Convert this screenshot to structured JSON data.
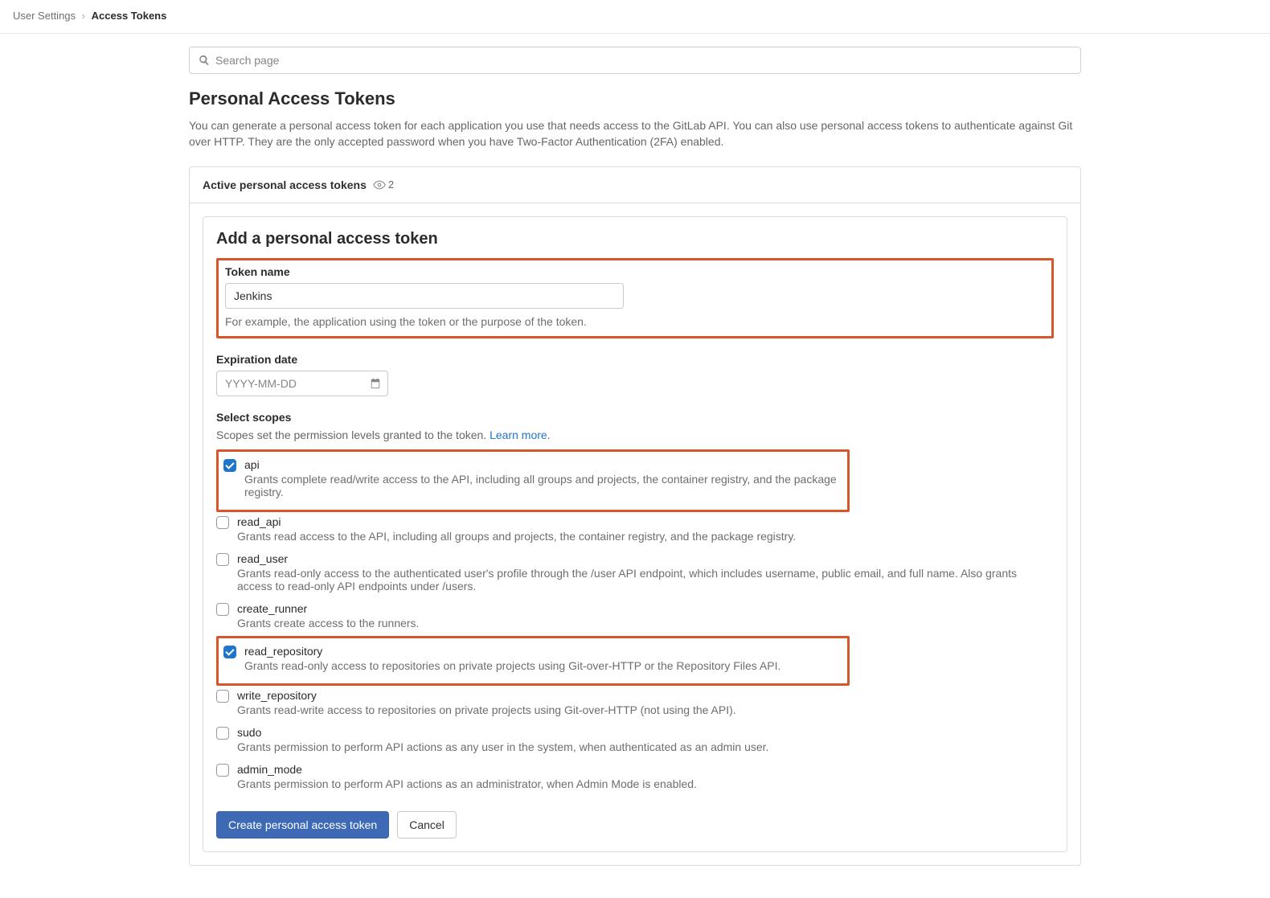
{
  "breadcrumbs": {
    "parent": "User Settings",
    "current": "Access Tokens"
  },
  "search": {
    "placeholder": "Search page"
  },
  "page": {
    "title": "Personal Access Tokens",
    "description": "You can generate a personal access token for each application you use that needs access to the GitLab API. You can also use personal access tokens to authenticate against Git over HTTP. They are the only accepted password when you have Two-Factor Authentication (2FA) enabled."
  },
  "panel": {
    "header": "Active personal access tokens",
    "count": "2"
  },
  "form": {
    "title": "Add a personal access token",
    "token_name_label": "Token name",
    "token_name_value": "Jenkins",
    "token_name_hint": "For example, the application using the token or the purpose of the token.",
    "expiration_label": "Expiration date",
    "expiration_placeholder": "YYYY-MM-DD",
    "scopes_label": "Select scopes",
    "scopes_desc_prefix": "Scopes set the permission levels granted to the token. ",
    "scopes_learn_more": "Learn more",
    "scopes_desc_suffix": ".",
    "create_label": "Create personal access token",
    "cancel_label": "Cancel"
  },
  "scopes": [
    {
      "key": "api",
      "name": "api",
      "desc": "Grants complete read/write access to the API, including all groups and projects, the container registry, and the package registry.",
      "checked": true,
      "highlight": true
    },
    {
      "key": "read_api",
      "name": "read_api",
      "desc": "Grants read access to the API, including all groups and projects, the container registry, and the package registry.",
      "checked": false,
      "highlight": false
    },
    {
      "key": "read_user",
      "name": "read_user",
      "desc": "Grants read-only access to the authenticated user's profile through the /user API endpoint, which includes username, public email, and full name. Also grants access to read-only API endpoints under /users.",
      "checked": false,
      "highlight": false
    },
    {
      "key": "create_runner",
      "name": "create_runner",
      "desc": "Grants create access to the runners.",
      "checked": false,
      "highlight": false
    },
    {
      "key": "read_repository",
      "name": "read_repository",
      "desc": "Grants read-only access to repositories on private projects using Git-over-HTTP or the Repository Files API.",
      "checked": true,
      "highlight": true
    },
    {
      "key": "write_repository",
      "name": "write_repository",
      "desc": "Grants read-write access to repositories on private projects using Git-over-HTTP (not using the API).",
      "checked": false,
      "highlight": false
    },
    {
      "key": "sudo",
      "name": "sudo",
      "desc": "Grants permission to perform API actions as any user in the system, when authenticated as an admin user.",
      "checked": false,
      "highlight": false
    },
    {
      "key": "admin_mode",
      "name": "admin_mode",
      "desc": "Grants permission to perform API actions as an administrator, when Admin Mode is enabled.",
      "checked": false,
      "highlight": false
    }
  ]
}
